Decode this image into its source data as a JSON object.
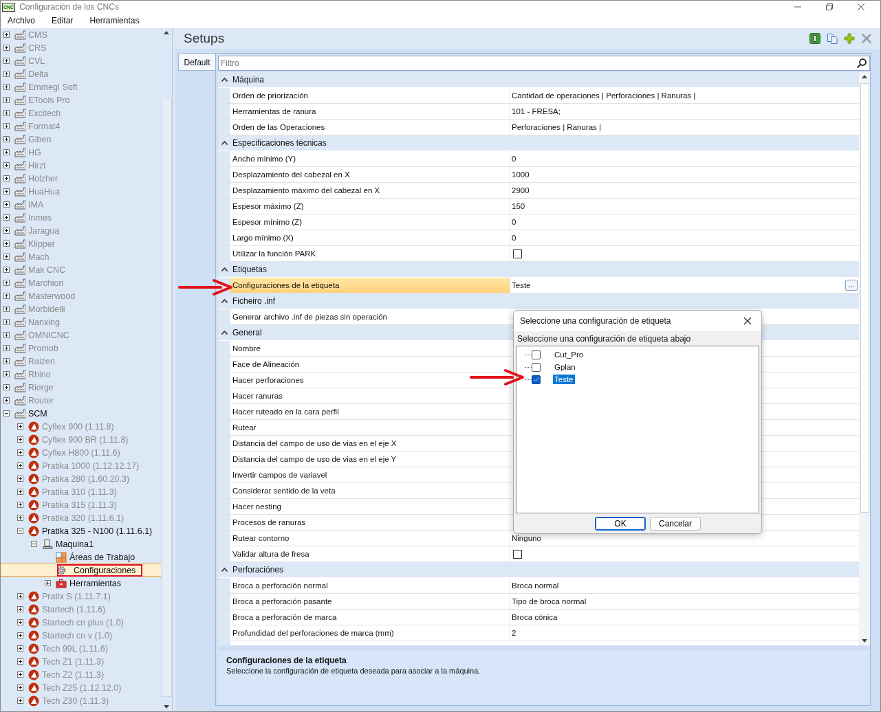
{
  "window": {
    "title": "Configuración de los CNCs",
    "app_icon_text": "CNC"
  },
  "menu": [
    "Archivo",
    "Editar",
    "Herramientas"
  ],
  "tree": [
    {
      "label": "CMS",
      "kind": "factory",
      "expanded": false,
      "dimmed": true
    },
    {
      "label": "CRS",
      "kind": "factory",
      "expanded": false,
      "dimmed": true
    },
    {
      "label": "CVL",
      "kind": "factory",
      "expanded": false,
      "dimmed": true
    },
    {
      "label": "Delta",
      "kind": "factory",
      "expanded": false,
      "dimmed": true
    },
    {
      "label": "Emmegi Soft",
      "kind": "factory",
      "expanded": false,
      "dimmed": true
    },
    {
      "label": "ETools Pro",
      "kind": "factory",
      "expanded": false,
      "dimmed": true
    },
    {
      "label": "Excitech",
      "kind": "factory",
      "expanded": false,
      "dimmed": true
    },
    {
      "label": "Format4",
      "kind": "factory",
      "expanded": false,
      "dimmed": true
    },
    {
      "label": "Giben",
      "kind": "factory",
      "expanded": false,
      "dimmed": true
    },
    {
      "label": "HG",
      "kind": "factory",
      "expanded": false,
      "dimmed": true
    },
    {
      "label": "Hirzt",
      "kind": "factory",
      "expanded": false,
      "dimmed": true
    },
    {
      "label": "Holzher",
      "kind": "factory",
      "expanded": false,
      "dimmed": true
    },
    {
      "label": "HuaHua",
      "kind": "factory",
      "expanded": false,
      "dimmed": true
    },
    {
      "label": "IMA",
      "kind": "factory",
      "expanded": false,
      "dimmed": true
    },
    {
      "label": "Inmes",
      "kind": "factory",
      "expanded": false,
      "dimmed": true
    },
    {
      "label": "Jaragua",
      "kind": "factory",
      "expanded": false,
      "dimmed": true
    },
    {
      "label": "Klipper",
      "kind": "factory",
      "expanded": false,
      "dimmed": true
    },
    {
      "label": "Mach",
      "kind": "factory",
      "expanded": false,
      "dimmed": true
    },
    {
      "label": "Mak CNC",
      "kind": "factory",
      "expanded": false,
      "dimmed": true
    },
    {
      "label": "Marchiori",
      "kind": "factory",
      "expanded": false,
      "dimmed": true
    },
    {
      "label": "Masterwood",
      "kind": "factory",
      "expanded": false,
      "dimmed": true
    },
    {
      "label": "Morbidelli",
      "kind": "factory",
      "expanded": false,
      "dimmed": true
    },
    {
      "label": "Nanxing",
      "kind": "factory",
      "expanded": false,
      "dimmed": true
    },
    {
      "label": "OMNICNC",
      "kind": "factory",
      "expanded": false,
      "dimmed": true
    },
    {
      "label": "Promob",
      "kind": "factory",
      "expanded": false,
      "dimmed": true
    },
    {
      "label": "Raizen",
      "kind": "factory",
      "expanded": false,
      "dimmed": true
    },
    {
      "label": "Rhino",
      "kind": "factory",
      "expanded": false,
      "dimmed": true
    },
    {
      "label": "Rierge",
      "kind": "factory",
      "expanded": false,
      "dimmed": true
    },
    {
      "label": "Router",
      "kind": "factory",
      "expanded": false,
      "dimmed": true
    },
    {
      "label": "SCM",
      "kind": "factory",
      "expanded": true,
      "dimmed": false,
      "children": [
        {
          "label": "Cyflex 900 (1.11.8)",
          "kind": "machine",
          "expanded": false,
          "dimmed": true
        },
        {
          "label": "Cyflex 900 BR (1.11.8)",
          "kind": "machine",
          "expanded": false,
          "dimmed": true
        },
        {
          "label": "Cyflex H800 (1.11.6)",
          "kind": "machine",
          "expanded": false,
          "dimmed": true
        },
        {
          "label": "Pratika 1000 (1.12.12.17)",
          "kind": "machine",
          "expanded": false,
          "dimmed": true
        },
        {
          "label": "Pratika 280 (1.60.20.3)",
          "kind": "machine",
          "expanded": false,
          "dimmed": true
        },
        {
          "label": "Pratika 310 (1.11.3)",
          "kind": "machine",
          "expanded": false,
          "dimmed": true
        },
        {
          "label": "Pratika 315 (1.11.3)",
          "kind": "machine",
          "expanded": false,
          "dimmed": true
        },
        {
          "label": "Pratika 320 (1.11.6.1)",
          "kind": "machine",
          "expanded": false,
          "dimmed": true
        },
        {
          "label": "Pratika 325 - N100 (1.11.6.1)",
          "kind": "machine",
          "expanded": true,
          "dimmed": false,
          "children": [
            {
              "label": "Maquina1",
              "kind": "station",
              "expanded": true,
              "dimmed": false,
              "children": [
                {
                  "label": "Áreas de Trabajo",
                  "kind": "areas",
                  "dimmed": false,
                  "selected": false
                },
                {
                  "label": "Configuraciones",
                  "kind": "gear",
                  "dimmed": false,
                  "selected": true
                },
                {
                  "label": "Herramientas",
                  "kind": "toolbox",
                  "expanded": false,
                  "dimmed": false,
                  "selected": false
                }
              ]
            }
          ]
        },
        {
          "label": "Pratix S (1.11.7.1)",
          "kind": "machine",
          "expanded": false,
          "dimmed": true
        },
        {
          "label": "Startech (1.11.6)",
          "kind": "machine",
          "expanded": false,
          "dimmed": true
        },
        {
          "label": "Startech cn plus (1.0)",
          "kind": "machine",
          "expanded": false,
          "dimmed": true
        },
        {
          "label": "Startech cn v (1.0)",
          "kind": "machine",
          "expanded": false,
          "dimmed": true
        },
        {
          "label": "Tech 99L (1.11.6)",
          "kind": "machine",
          "expanded": false,
          "dimmed": true
        },
        {
          "label": "Tech Z1 (1.11.3)",
          "kind": "machine",
          "expanded": false,
          "dimmed": true
        },
        {
          "label": "Tech Z2 (1.11.3)",
          "kind": "machine",
          "expanded": false,
          "dimmed": true
        },
        {
          "label": "Tech Z25 (1.12.12.0)",
          "kind": "machine",
          "expanded": false,
          "dimmed": true
        },
        {
          "label": "Tech Z30 (1.11.3)",
          "kind": "machine",
          "expanded": false,
          "dimmed": true
        }
      ]
    }
  ],
  "panel": {
    "title": "Setups",
    "tools": [
      {
        "kind": "info",
        "disabled": false
      },
      {
        "kind": "copy",
        "disabled": false
      },
      {
        "kind": "add",
        "disabled": false
      },
      {
        "kind": "delete",
        "disabled": true
      }
    ],
    "tabs": [
      {
        "label": "Default",
        "selected": true
      }
    ],
    "filter": {
      "placeholder": "Filtro"
    },
    "categories": [
      {
        "name": "Máquina",
        "expanded": true,
        "rows": [
          {
            "name": "Orden de priorización",
            "kind": "text",
            "selected": false,
            "value": "Cantidad de operaciones | Perforaciones | Ranuras |"
          },
          {
            "name": "Herramientas de ranura",
            "kind": "text",
            "selected": false,
            "value": "101 - FRESA;"
          },
          {
            "name": "Orden de las Operaciones",
            "kind": "text",
            "selected": false,
            "value": "Perforaciones | Ranuras |"
          }
        ]
      },
      {
        "name": "Especificaciones técnicas",
        "expanded": true,
        "rows": [
          {
            "name": "Ancho mínimo (Y)",
            "kind": "text",
            "selected": false,
            "value": "0"
          },
          {
            "name": "Desplazamiento del cabezal en X",
            "kind": "text",
            "selected": false,
            "value": "1000"
          },
          {
            "name": "Desplazamiento máximo del cabezal en X",
            "kind": "text",
            "selected": false,
            "value": "2900"
          },
          {
            "name": "Espesor máximo (Z)",
            "kind": "text",
            "selected": false,
            "value": "150"
          },
          {
            "name": "Espesor mínimo (Z)",
            "kind": "text",
            "selected": false,
            "value": "0"
          },
          {
            "name": "Largo mínimo (X)",
            "kind": "text",
            "selected": false,
            "value": "0"
          },
          {
            "name": "Utilizar la función PARK",
            "kind": "checkbox",
            "selected": false,
            "checked": false
          }
        ]
      },
      {
        "name": "Etiquetas",
        "expanded": true,
        "rows": [
          {
            "name": "Configuraciones de la etiqueta",
            "kind": "picker",
            "selected": true,
            "value": "Teste",
            "button": "..."
          }
        ]
      },
      {
        "name": "Ficheiro .inf",
        "expanded": true,
        "rows": [
          {
            "name": "Generar archivo .inf de piezas sin operación",
            "kind": "text",
            "selected": false
          }
        ]
      },
      {
        "name": "General",
        "expanded": true,
        "rows": [
          {
            "name": "Nombre",
            "kind": "text",
            "selected": false
          },
          {
            "name": "Face de Alineación",
            "kind": "text",
            "selected": false
          },
          {
            "name": "Hacer perforaciones",
            "kind": "text",
            "selected": false
          },
          {
            "name": "Hacer ranuras",
            "kind": "text",
            "selected": false
          },
          {
            "name": "Hacer ruteado en la cara perfil",
            "kind": "text",
            "selected": false
          },
          {
            "name": "Rutear",
            "kind": "text",
            "selected": false
          },
          {
            "name": "Distancia del campo de uso de vias en el eje X",
            "kind": "text",
            "selected": false
          },
          {
            "name": "Distancia del campo de uso de vias en el eje Y",
            "kind": "text",
            "selected": false
          },
          {
            "name": "Invertir campos de variavel",
            "kind": "text",
            "selected": false
          },
          {
            "name": "Considerar sentido de la veta",
            "kind": "text",
            "selected": false
          },
          {
            "name": "Hacer nesting",
            "kind": "text",
            "selected": false
          },
          {
            "name": "Procesos de ranuras",
            "kind": "text",
            "selected": false
          },
          {
            "name": "Rutear contorno",
            "kind": "text",
            "selected": false,
            "value": "Ninguno"
          },
          {
            "name": "Validar altura de fresa",
            "kind": "checkbox",
            "selected": false,
            "checked": false
          }
        ]
      },
      {
        "name": "Perforaciónes",
        "expanded": true,
        "rows": [
          {
            "name": "Broca a perforación normal",
            "kind": "text",
            "selected": false,
            "value": "Broca normal"
          },
          {
            "name": "Broca a perforación pasante",
            "kind": "text",
            "selected": false,
            "value": "Tipo de broca normal"
          },
          {
            "name": "Broca a perforación de marca",
            "kind": "text",
            "selected": false,
            "value": "Broca cónica"
          },
          {
            "name": "Profundidad del perforaciones de marca (mm)",
            "kind": "text",
            "selected": false,
            "value": "2"
          }
        ]
      }
    ],
    "description": {
      "title": "Configuraciones de la etiqueta",
      "text": "Seleccione la configuración de etiqueta deseada para asociar a la máquina."
    }
  },
  "dialog": {
    "title": "Seleccione una configuración de etiqueta",
    "prompt": "Seleccione una configuración de etiqueta abajo",
    "items": [
      {
        "label": "Cut_Pro",
        "checked": false,
        "selected": false
      },
      {
        "label": "Gplan",
        "checked": false,
        "selected": false
      },
      {
        "label": "Teste",
        "checked": true,
        "selected": true
      }
    ],
    "buttons": [
      {
        "label": "OK",
        "default": true
      },
      {
        "label": "Cancelar",
        "default": false
      }
    ]
  },
  "annotations": [
    {
      "kind": "arrow"
    },
    {
      "kind": "arrow"
    }
  ]
}
